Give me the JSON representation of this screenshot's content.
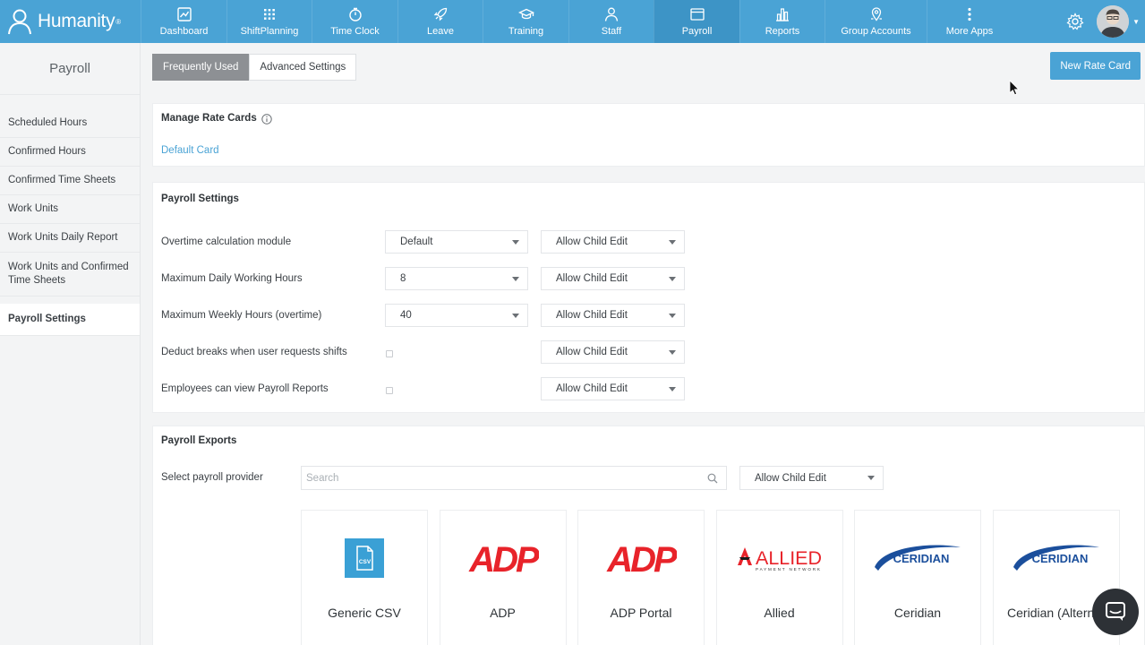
{
  "brand": {
    "name": "Humanity",
    "reg": "®"
  },
  "nav": {
    "items": [
      {
        "label": "Dashboard"
      },
      {
        "label": "ShiftPlanning"
      },
      {
        "label": "Time Clock"
      },
      {
        "label": "Leave"
      },
      {
        "label": "Training"
      },
      {
        "label": "Staff"
      },
      {
        "label": "Payroll"
      },
      {
        "label": "Reports"
      },
      {
        "label": "Group Accounts"
      },
      {
        "label": "More Apps"
      }
    ],
    "active": "Payroll"
  },
  "sidebar": {
    "title": "Payroll",
    "items": [
      {
        "label": "Scheduled Hours"
      },
      {
        "label": "Confirmed Hours"
      },
      {
        "label": "Confirmed Time Sheets"
      },
      {
        "label": "Work Units"
      },
      {
        "label": "Work Units Daily Report"
      },
      {
        "label": "Work Units and Confirmed Time Sheets"
      },
      {
        "label": "Payroll Settings"
      }
    ]
  },
  "tabs": [
    {
      "label": "Frequently Used"
    },
    {
      "label": "Advanced Settings"
    }
  ],
  "toolbar": {
    "new_rate_card": "New Rate Card"
  },
  "rate_cards": {
    "title": "Manage Rate Cards",
    "link": "Default Card"
  },
  "payroll_settings": {
    "title": "Payroll Settings",
    "rows": [
      {
        "label": "Overtime calculation module",
        "value": "Default",
        "permission": "Allow Child Edit"
      },
      {
        "label": "Maximum Daily Working Hours",
        "value": "8",
        "permission": "Allow Child Edit"
      },
      {
        "label": "Maximum Weekly Hours (overtime)",
        "value": "40",
        "permission": "Allow Child Edit"
      },
      {
        "label": "Deduct breaks when user requests shifts",
        "permission": "Allow Child Edit"
      },
      {
        "label": "Employees can view Payroll Reports",
        "permission": "Allow Child Edit"
      }
    ]
  },
  "payroll_exports": {
    "title": "Payroll Exports",
    "provider_label": "Select payroll provider",
    "search_placeholder": "Search",
    "permission": "Allow Child Edit",
    "providers": [
      {
        "name": "Generic CSV",
        "logo_text": "CSV"
      },
      {
        "name": "ADP",
        "logo_text": "ADP"
      },
      {
        "name": "ADP Portal",
        "logo_text": "ADP"
      },
      {
        "name": "Allied",
        "logo_text": "ALLIED",
        "logo_sub": "PAYMENT NETWORK"
      },
      {
        "name": "Ceridian",
        "logo_text": "CERIDIAN"
      },
      {
        "name": "Ceridian (Alternat",
        "logo_text": "CERIDIAN"
      }
    ]
  },
  "colors": {
    "accent": "#4aa3d5",
    "nav_active": "#3d94c6",
    "adp_red": "#e8232a",
    "ceridian_blue": "#1b4f9c"
  }
}
